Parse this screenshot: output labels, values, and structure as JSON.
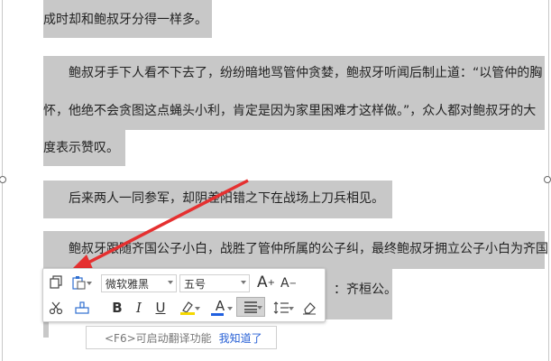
{
  "document": {
    "lines": [
      "成时却和鲍叔牙分得一样多。",
      "鲍叔牙手下人看不下去了，纷纷暗地骂管仲贪婪，鲍叔牙听闻后制止道：“以管仲的胸",
      "怀，他绝不会贪图这点蝇头小利，肯定是因为家里困难才这样做。”，众人都对鲍叔牙的大",
      "度表示赞叹。",
      "后来两人一同参军，却阴差阳错之下在战场上刀兵相见。",
      "鲍叔牙跟随齐国公子小白，战胜了管仲所属的公子纠，最终鲍叔牙拥立公子小白为齐国",
      "：齐桓公。"
    ]
  },
  "toolbar": {
    "font_name": "微软雅黑",
    "font_size": "五号",
    "grow_font_label": "A",
    "shrink_font_label": "A",
    "bold_label": "B",
    "italic_label": "I",
    "underline_label": "U",
    "font_color_label": "A",
    "highlight_color": "#f5d800",
    "font_color": "#2060e0"
  },
  "hint": {
    "key_text": "<F6>可启动翻译功能",
    "link_text": "我知道了",
    "link_color": "#2a62d6"
  },
  "annotation": {
    "arrow_color": "#e53030"
  }
}
